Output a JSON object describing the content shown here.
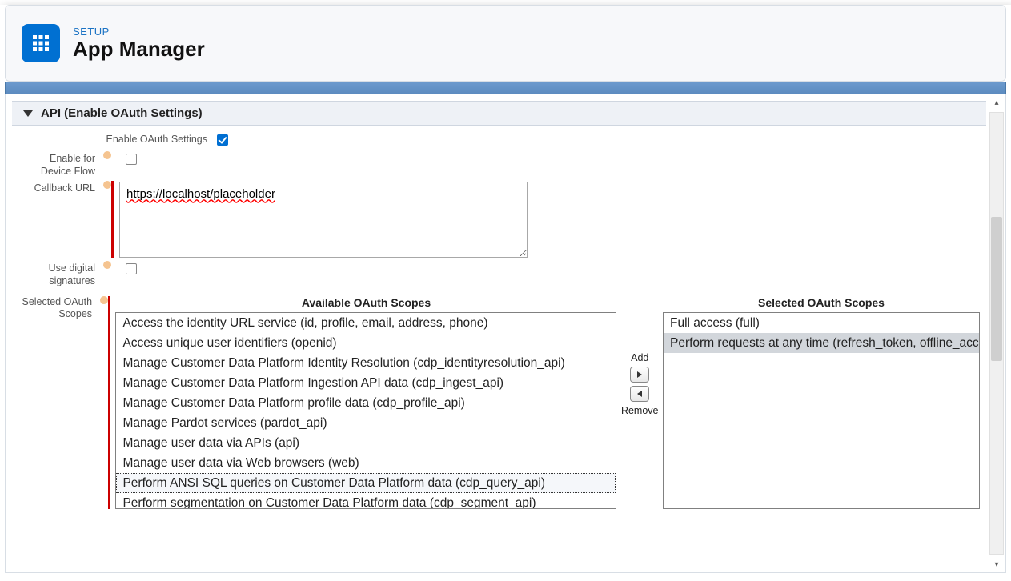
{
  "header": {
    "setup_label": "SETUP",
    "page_title": "App Manager"
  },
  "section": {
    "title": "API (Enable OAuth Settings)"
  },
  "fields": {
    "enable_oauth_label": "Enable OAuth Settings",
    "enable_oauth_checked": true,
    "enable_device_flow_label": "Enable for Device Flow",
    "enable_device_flow_checked": false,
    "callback_url_label": "Callback URL",
    "callback_url_value": "https://localhost/placeholder",
    "use_digital_sig_label": "Use digital signatures",
    "use_digital_sig_checked": false,
    "selected_scopes_label": "Selected OAuth Scopes"
  },
  "scopes": {
    "available_title": "Available OAuth Scopes",
    "selected_title": "Selected OAuth Scopes",
    "add_label": "Add",
    "remove_label": "Remove",
    "available": [
      "Access the identity URL service (id, profile, email, address, phone)",
      "Access unique user identifiers (openid)",
      "Manage Customer Data Platform Identity Resolution (cdp_identityresolution_api)",
      "Manage Customer Data Platform Ingestion API data (cdp_ingest_api)",
      "Manage Customer Data Platform profile data (cdp_profile_api)",
      "Manage Pardot services (pardot_api)",
      "Manage user data via APIs (api)",
      "Manage user data via Web browsers (web)",
      "Perform ANSI SQL queries on Customer Data Platform data (cdp_query_api)",
      "Perform segmentation on Customer Data Platform data (cdp_segment_api)"
    ],
    "available_highlight_index": 8,
    "selected": [
      "Full access (full)",
      "Perform requests at any time (refresh_token, offline_access)"
    ]
  }
}
